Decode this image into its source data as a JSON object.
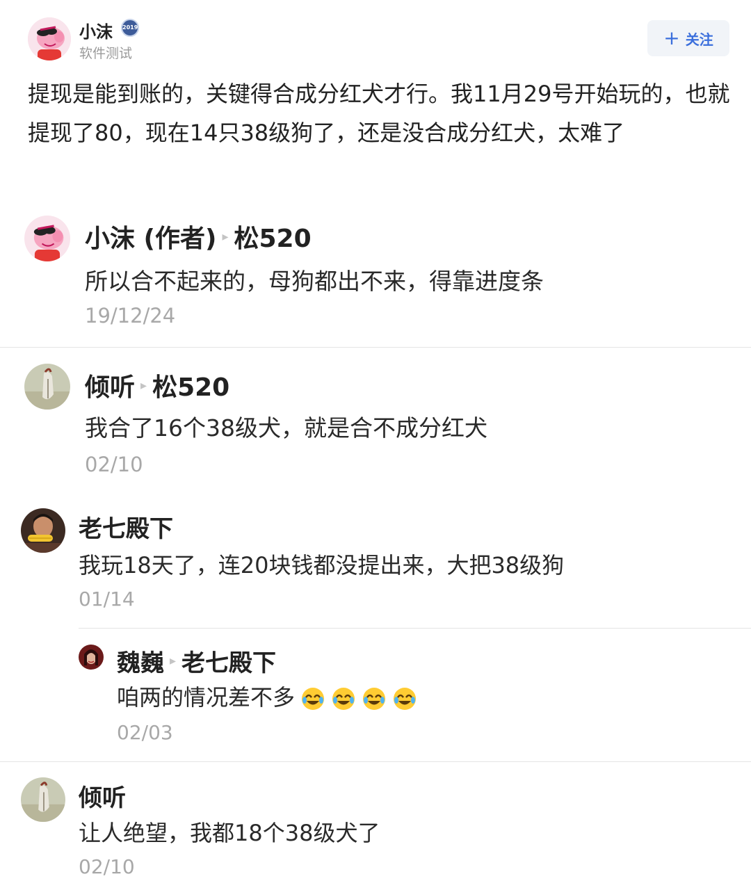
{
  "post": {
    "author": {
      "name": "小沫",
      "subtitle": "软件测试",
      "badge": "2019"
    },
    "follow": {
      "icon": "plus-icon",
      "label": "关注"
    },
    "content": "提现是能到账的，关键得合成分红犬才行。我11月29号开始玩的，也就提现了80，现在14只38级狗了，还是没合成分红犬，太难了"
  },
  "comments": [
    {
      "author": "小沫 (作者)",
      "reply_to": "松520",
      "text": "所以合不起来的，母狗都出不来，得靠进度条",
      "date": "19/12/24"
    },
    {
      "author": "倾听",
      "reply_to": "松520",
      "text": "我合了16个38级犬，就是合不成分红犬",
      "date": "02/10"
    },
    {
      "author": "老七殿下",
      "text": "我玩18天了，连20块钱都没提出来，大把38级狗",
      "date": "01/14",
      "reply": {
        "author": "魏巍",
        "reply_to": "老七殿下",
        "text": "咱两的情况差不多",
        "emoji": "rofl-emoji",
        "date": "02/03"
      }
    },
    {
      "author": "倾听",
      "text": "让人绝望，我都18个38级犬了",
      "date": "02/10"
    }
  ],
  "colors": {
    "accent": "#3b6fdc",
    "muted": "#a8a8a8",
    "divider": "#e4e4e4"
  }
}
